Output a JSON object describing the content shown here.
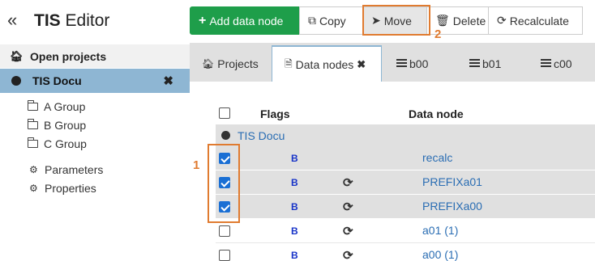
{
  "sidebar": {
    "collapse_glyph": "«",
    "title_bold": "TIS",
    "title_rest": " Editor",
    "open_projects_label": "Open projects",
    "project_name": "TIS Docu",
    "groups": [
      "A Group",
      "B Group",
      "C Group"
    ],
    "tools": [
      {
        "icon": "gear-icon",
        "glyph": "⚙",
        "label": "Parameters"
      },
      {
        "icon": "gears-icon",
        "glyph": "⚙",
        "label": "Properties"
      }
    ]
  },
  "toolbar": {
    "add_label": "Add data node",
    "copy_label": "Copy",
    "move_label": "Move",
    "delete_label": "Delete",
    "recalculate_label": "Recalculate"
  },
  "tabs": [
    {
      "label": "Projects",
      "icon": "home-icon"
    },
    {
      "label": "Data nodes",
      "icon": "file-icon",
      "active": true
    },
    {
      "label": "b00",
      "icon": "database-icon"
    },
    {
      "label": "b01",
      "icon": "database-icon"
    },
    {
      "label": "c00",
      "icon": "database-icon"
    }
  ],
  "table": {
    "headers": {
      "flags": "Flags",
      "data_node": "Data node"
    },
    "project_line": "TIS Docu",
    "rows": [
      {
        "checked": true,
        "flag": "B",
        "refresh": false,
        "name": "recalc"
      },
      {
        "checked": true,
        "flag": "B",
        "refresh": true,
        "name": "PREFIXa01"
      },
      {
        "checked": true,
        "flag": "B",
        "refresh": true,
        "name": "PREFIXa00"
      },
      {
        "checked": false,
        "flag": "B",
        "refresh": true,
        "name": "a01 (1)"
      },
      {
        "checked": false,
        "flag": "B",
        "refresh": true,
        "name": "a00 (1)"
      }
    ]
  },
  "callouts": {
    "one": "1",
    "two": "2"
  },
  "colors": {
    "accent_green": "#1e9e4a",
    "selection_blue": "#8eb6d3",
    "callout_orange": "#e07b30",
    "link_blue": "#2a6db3",
    "flag_blue": "#1733c8"
  }
}
